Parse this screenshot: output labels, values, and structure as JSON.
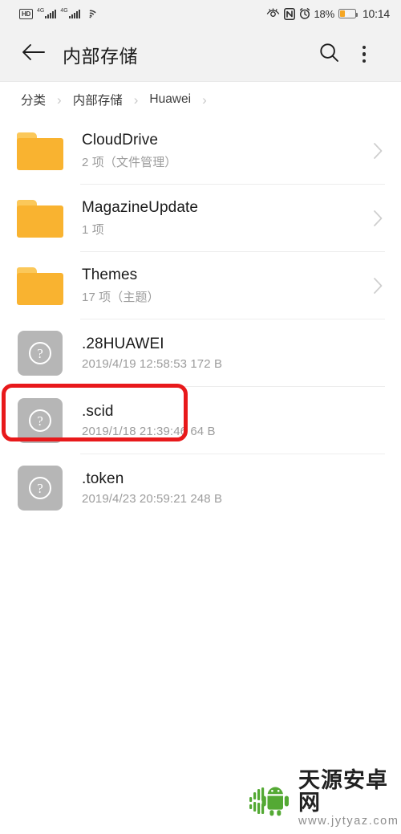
{
  "status_bar": {
    "hd_label": "HD",
    "sim1_network": "4G",
    "sim2_network": "4G",
    "wifi_icon": "wifi-icon",
    "eye_comfort_icon": "eye-comfort-icon",
    "nfc_icon": "nfc-icon",
    "alarm_icon": "alarm-icon",
    "battery_percent": "18%",
    "battery_icon": "battery-charging-icon",
    "clock": "10:14"
  },
  "app_bar": {
    "back_icon": "back-arrow-icon",
    "title": "内部存储",
    "search_icon": "search-icon",
    "overflow_icon": "more-vertical-icon"
  },
  "breadcrumb": {
    "separator": "›",
    "items": [
      {
        "label": "分类"
      },
      {
        "label": "内部存储"
      },
      {
        "label": "Huawei"
      }
    ]
  },
  "file_list": {
    "rows": [
      {
        "name": "CloudDrive",
        "meta": "2 项（文件管理）",
        "icon": "folder-icon",
        "type": "folder",
        "highlighted": false
      },
      {
        "name": "MagazineUpdate",
        "meta": "1 项",
        "icon": "folder-icon",
        "type": "folder",
        "highlighted": false
      },
      {
        "name": "Themes",
        "meta": "17 项（主题）",
        "icon": "folder-icon",
        "type": "folder",
        "highlighted": true
      },
      {
        "name": ".28HUAWEI",
        "meta": "2019/4/19 12:58:53 172 B",
        "icon": "unknown-file-icon",
        "type": "file",
        "highlighted": false
      },
      {
        "name": ".scid",
        "meta": "2019/1/18 21:39:46 64 B",
        "icon": "unknown-file-icon",
        "type": "file",
        "highlighted": false
      },
      {
        "name": ".token",
        "meta": "2019/4/23 20:59:21 248 B",
        "icon": "unknown-file-icon",
        "type": "file",
        "highlighted": false
      }
    ]
  },
  "annotation": {
    "shape": "rounded-rectangle",
    "color": "#e8191b",
    "targets_row": "Themes"
  },
  "watermark": {
    "logo_icon": "android-robot-logo",
    "site_name": "天源安卓网",
    "site_url": "www.jytyaz.com",
    "logo_color": "#4fa72e"
  },
  "colors": {
    "folder": "#f9b330",
    "folder_tab": "#fbc85a",
    "file_tile": "#b6b6b6",
    "chrome_bg": "#f2f2f2",
    "page_bg": "#ffffff",
    "divider": "#ededed",
    "title_text": "#1b1b1b",
    "meta_text": "#9c9c9c",
    "accent_red": "#e8191b"
  }
}
